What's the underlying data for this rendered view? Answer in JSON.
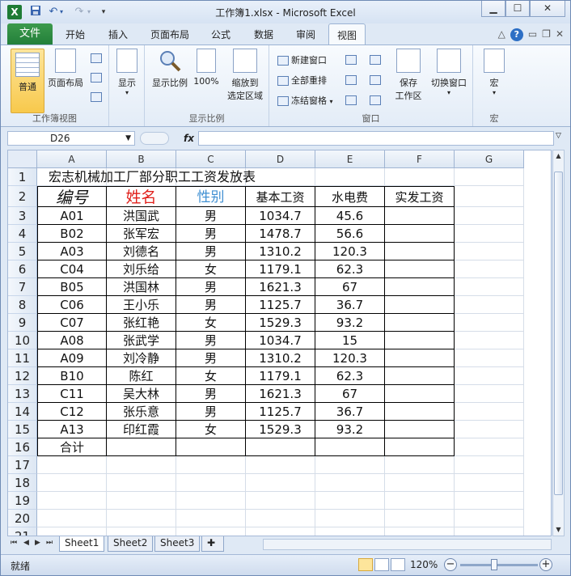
{
  "window": {
    "title": "工作簿1.xlsx  -  Microsoft Excel",
    "app_icon": "X",
    "min_symbol": "▁",
    "max_symbol": "☐",
    "close_symbol": "✕"
  },
  "quick_access": {
    "save_icon": "save-icon",
    "undo_icon": "undo-icon",
    "redo_icon": "redo-icon"
  },
  "ribbon_tabs": [
    {
      "label": "文件"
    },
    {
      "label": "开始"
    },
    {
      "label": "插入"
    },
    {
      "label": "页面布局"
    },
    {
      "label": "公式"
    },
    {
      "label": "数据"
    },
    {
      "label": "审阅"
    },
    {
      "label": "视图"
    }
  ],
  "ribbon": {
    "workbook_views": {
      "label": "工作簿视图",
      "normal": "普通",
      "page_layout": "页面布局"
    },
    "show": {
      "label": "显示"
    },
    "zoom_group": {
      "label": "显示比例",
      "zoom": "显示比例",
      "hundred": "100%",
      "zoom_selection_line1": "缩放到",
      "zoom_selection_line2": "选定区域"
    },
    "window_group": {
      "label": "窗口",
      "new_window": "新建窗口",
      "arrange_all": "全部重排",
      "freeze_panes": "冻结窗格",
      "save_workspace_line1": "保存",
      "save_workspace_line2": "工作区",
      "switch_windows": "切换窗口"
    },
    "macros_group": {
      "label": "宏",
      "macros": "宏"
    }
  },
  "formula_bar": {
    "name_box": "D26",
    "fx": "fx",
    "formula": ""
  },
  "columns": [
    "A",
    "B",
    "C",
    "D",
    "E",
    "F",
    "G"
  ],
  "rows": [
    "1",
    "2",
    "3",
    "4",
    "5",
    "6",
    "7",
    "8",
    "9",
    "10",
    "11",
    "12",
    "13",
    "14",
    "15",
    "16",
    "17",
    "18",
    "19",
    "20",
    "21"
  ],
  "sheet": {
    "title": "宏志机械加工厂部分职工工资发放表",
    "headers": {
      "id": "编号",
      "name": "姓名",
      "gender": "性别",
      "base_salary": "基本工资",
      "utility": "水电费",
      "net_pay": "实发工资"
    },
    "header_colors": {
      "name": "#e0201b",
      "gender": "#3f8fd2"
    },
    "records": [
      {
        "id": "A01",
        "name": "洪国武",
        "gender": "男",
        "base": "1034.7",
        "utility": "45.6"
      },
      {
        "id": "B02",
        "name": "张军宏",
        "gender": "男",
        "base": "1478.7",
        "utility": "56.6"
      },
      {
        "id": "A03",
        "name": "刘德名",
        "gender": "男",
        "base": "1310.2",
        "utility": "120.3"
      },
      {
        "id": "C04",
        "name": "刘乐给",
        "gender": "女",
        "base": "1179.1",
        "utility": "62.3"
      },
      {
        "id": "B05",
        "name": "洪国林",
        "gender": "男",
        "base": "1621.3",
        "utility": "67"
      },
      {
        "id": "C06",
        "name": "王小乐",
        "gender": "男",
        "base": "1125.7",
        "utility": "36.7"
      },
      {
        "id": "C07",
        "name": "张红艳",
        "gender": "女",
        "base": "1529.3",
        "utility": "93.2"
      },
      {
        "id": "A08",
        "name": "张武学",
        "gender": "男",
        "base": "1034.7",
        "utility": "15"
      },
      {
        "id": "A09",
        "name": "刘冷静",
        "gender": "男",
        "base": "1310.2",
        "utility": "120.3"
      },
      {
        "id": "B10",
        "name": "陈红",
        "gender": "女",
        "base": "1179.1",
        "utility": "62.3"
      },
      {
        "id": "C11",
        "name": "吴大林",
        "gender": "男",
        "base": "1621.3",
        "utility": "67"
      },
      {
        "id": "C12",
        "name": "张乐意",
        "gender": "男",
        "base": "1125.7",
        "utility": "36.7"
      },
      {
        "id": "A13",
        "name": "印红霞",
        "gender": "女",
        "base": "1529.3",
        "utility": "93.2"
      }
    ],
    "total_label": "合计"
  },
  "sheet_tabs": [
    {
      "label": "Sheet1",
      "active": true
    },
    {
      "label": "Sheet2",
      "active": false
    },
    {
      "label": "Sheet3",
      "active": false
    }
  ],
  "status": {
    "ready": "就绪",
    "zoom": "120%"
  }
}
